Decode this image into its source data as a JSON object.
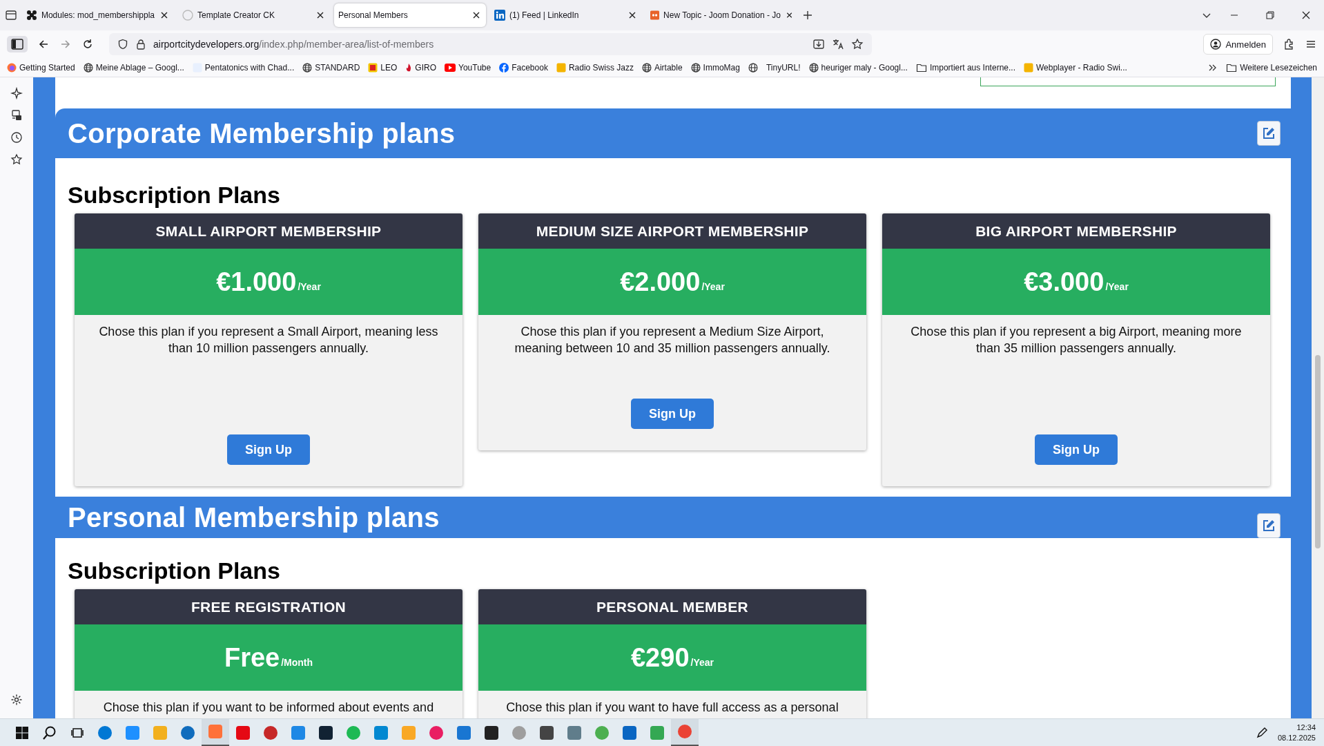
{
  "tabs": [
    {
      "title": "Modules: mod_membershippla",
      "selected": false
    },
    {
      "title": "Template Creator CK",
      "selected": false
    },
    {
      "title": "Personal Members",
      "selected": true
    },
    {
      "title": "(1) Feed | LinkedIn",
      "selected": false
    },
    {
      "title": "New Topic - Joom Donation - Jo",
      "selected": false
    }
  ],
  "address": {
    "host": "airportcitydevelopers.org",
    "path": "/index.php/member-area/list-of-members"
  },
  "account_button": "Anmelden",
  "bookmarks": [
    "Getting Started",
    "Meine Ablage – Googl...",
    "Pentatonics with Chad...",
    "STANDARD",
    "LEO",
    "GIRO",
    "YouTube",
    "Facebook",
    "Radio Swiss Jazz",
    "Airtable",
    "ImmoMag",
    "TinyURL!",
    "heuriger maly - Googl...",
    "Importiert aus Interne...",
    "Webplayer - Radio Swi..."
  ],
  "more_bookmarks": "Weitere Lesezeichen",
  "sections": [
    {
      "title": "Corporate Membership plans",
      "subtitle": "Subscription Plans",
      "plans": [
        {
          "name": "SMALL AIRPORT MEMBERSHIP",
          "price": "€1.000",
          "period": "/Year",
          "description": "Chose this plan if you represent a Small Airport, meaning less than 10 million passengers annually.",
          "button": "Sign Up"
        },
        {
          "name": "MEDIUM SIZE AIRPORT MEMBERSHIP",
          "price": "€2.000",
          "period": "/Year",
          "description": "Chose this plan if you represent a Medium Size Airport, meaning between 10 and 35 million passengers annually.",
          "button": "Sign Up"
        },
        {
          "name": "BIG AIRPORT MEMBERSHIP",
          "price": "€3.000",
          "period": "/Year",
          "description": "Chose this plan if you represent a big Airport, meaning more than 35 million passengers annually.",
          "button": "Sign Up"
        }
      ]
    },
    {
      "title": "Personal Membership plans",
      "subtitle": "Subscription Plans",
      "plans": [
        {
          "name": "FREE REGISTRATION",
          "price": "Free",
          "period": "/Month",
          "description": "Chose this plan if you want to be informed about events and"
        },
        {
          "name": "PERSONAL MEMBER",
          "price": "€290",
          "period": "/Year",
          "description": "Chose this plan if you want to have full access as a personal"
        }
      ]
    }
  ],
  "taskbar": {
    "time": "12:34",
    "date": "08.12.2025"
  }
}
